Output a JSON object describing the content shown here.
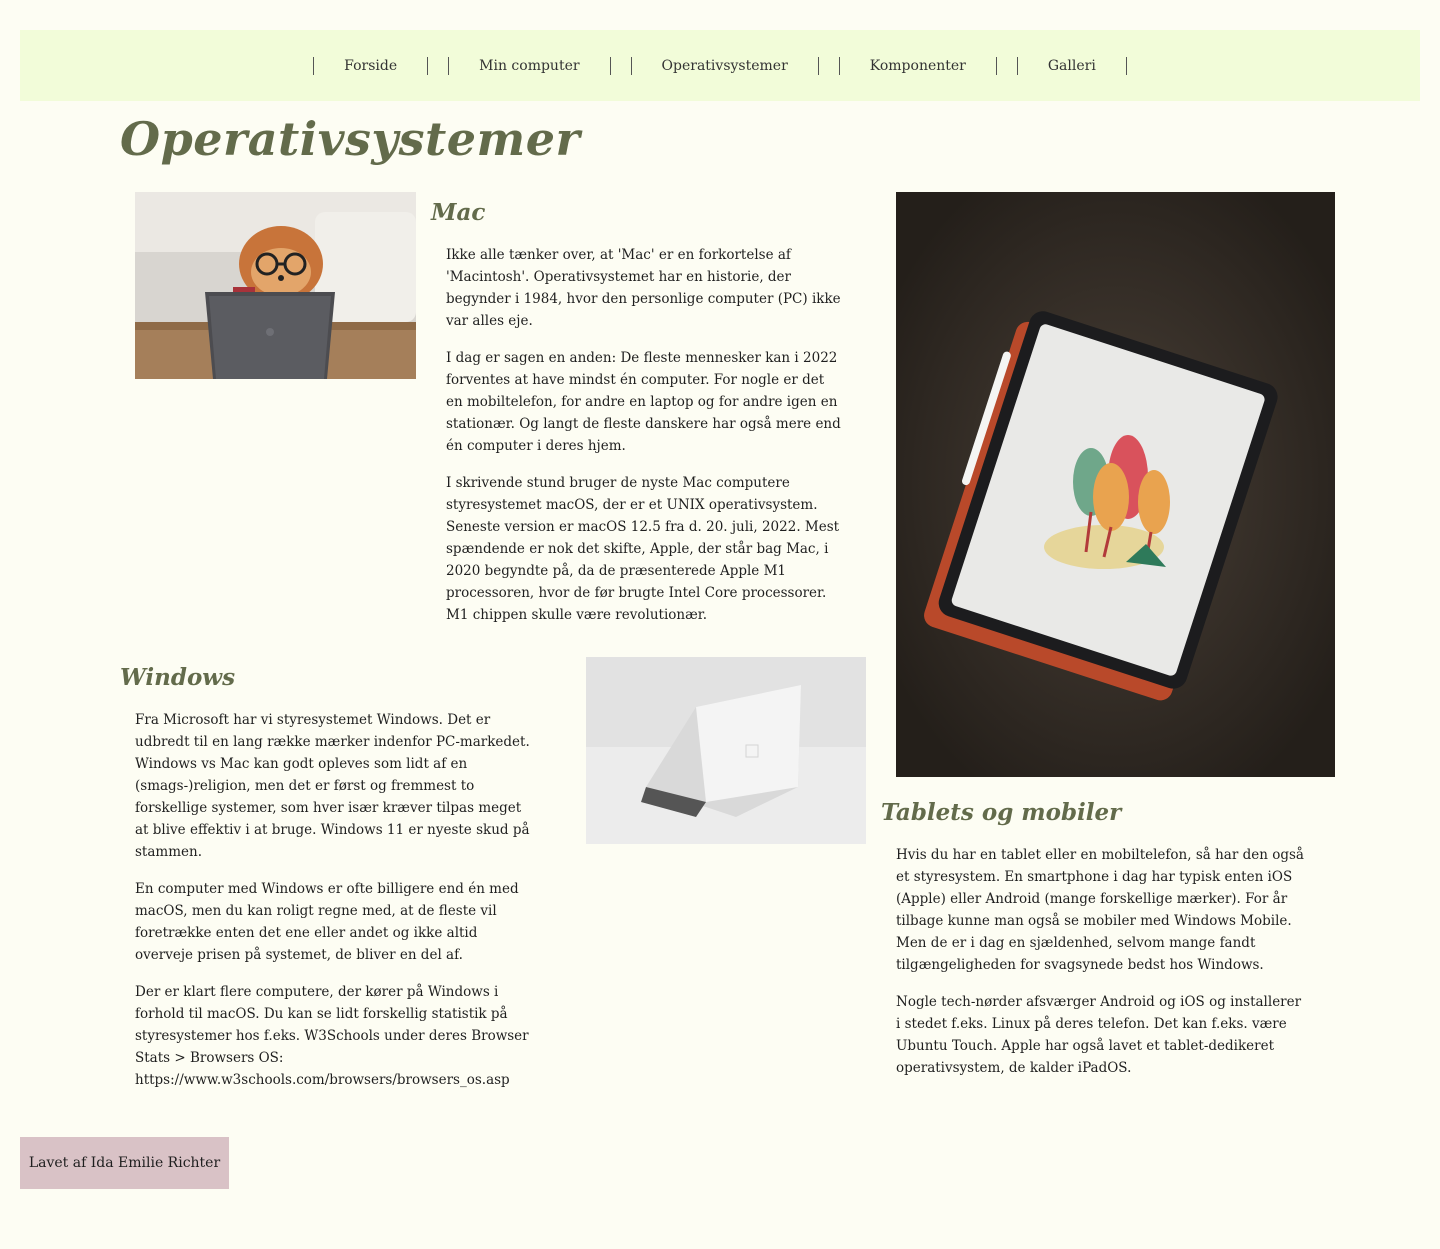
{
  "nav": {
    "items": [
      "Forside",
      "Min computer",
      "Operativsystemer",
      "Komponenter",
      "Galleri"
    ]
  },
  "page": {
    "title": "Operativsystemer"
  },
  "sections": {
    "mac": {
      "heading": "Mac",
      "paragraphs": [
        "Ikke alle tænker over, at 'Mac' er en forkortelse af 'Macintosh'. Operativsystemet har en historie, der begynder i 1984, hvor den personlige computer (PC) ikke var alles eje.",
        "I dag er sagen en anden: De fleste mennesker kan i 2022 forventes at have mindst én computer. For nogle er det en mobiltelefon, for andre en laptop og for andre igen en stationær. Og langt de fleste danskere har også mere end én computer i deres hjem.",
        "I skrivende stund bruger de nyste Mac computere styresystemet macOS, der er et UNIX operativsystem. Seneste version er macOS 12.5 fra d. 20. juli, 2022. Mest spændende er nok det skifte, Apple, der står bag Mac, i 2020 begyndte på, da de præsenterede Apple M1 processoren, hvor de før brugte Intel Core processorer. M1 chippen skulle være revolutionær."
      ]
    },
    "windows": {
      "heading": "Windows",
      "paragraphs": [
        "Fra Microsoft har vi styresystemet Windows. Det er udbredt til en lang række mærker indenfor PC-markedet. Windows vs Mac kan godt opleves som lidt af en (smags-)religion, men det er først og fremmest to forskellige systemer, som hver især kræver tilpas meget at blive effektiv i at bruge. Windows 11 er nyeste skud på stammen.",
        "En computer med Windows er ofte billigere end én med macOS, men du kan roligt regne med, at de fleste vil foretrække enten det ene eller andet og ikke altid overveje prisen på systemet, de bliver en del af.",
        "Der er klart flere computere, der kører på Windows i forhold til macOS. Du kan se lidt forskellig statistik på styresystemer hos f.eks. W3Schools under deres Browser Stats > Browsers OS: https://www.w3schools.com/browsers/browsers_os.asp"
      ]
    },
    "tablets": {
      "heading": "Tablets og mobiler",
      "paragraphs": [
        "Hvis du har en tablet eller en mobiltelefon, så har den også et styresystem. En smartphone i dag har typisk enten iOS (Apple) eller Android (mange forskellige mærker). For år tilbage kunne man også se mobiler med Windows Mobile. Men de er i dag en sjældenhed, selvom mange fandt tilgængeligheden for svagsynede bedst hos Windows.",
        "Nogle tech-nørder afsværger Android og iOS og installerer i stedet f.eks. Linux på deres telefon. Det kan f.eks. være Ubuntu Touch. Apple har også lavet et tablet-dedikeret operativsystem, de kalder iPadOS."
      ]
    }
  },
  "footer": {
    "text": "Lavet af Ida Emilie Richter"
  },
  "colors": {
    "background": "#fdfdf3",
    "nav_background": "#f2fcd9",
    "heading": "#636b4b",
    "footer_background": "#d9c2c6"
  }
}
